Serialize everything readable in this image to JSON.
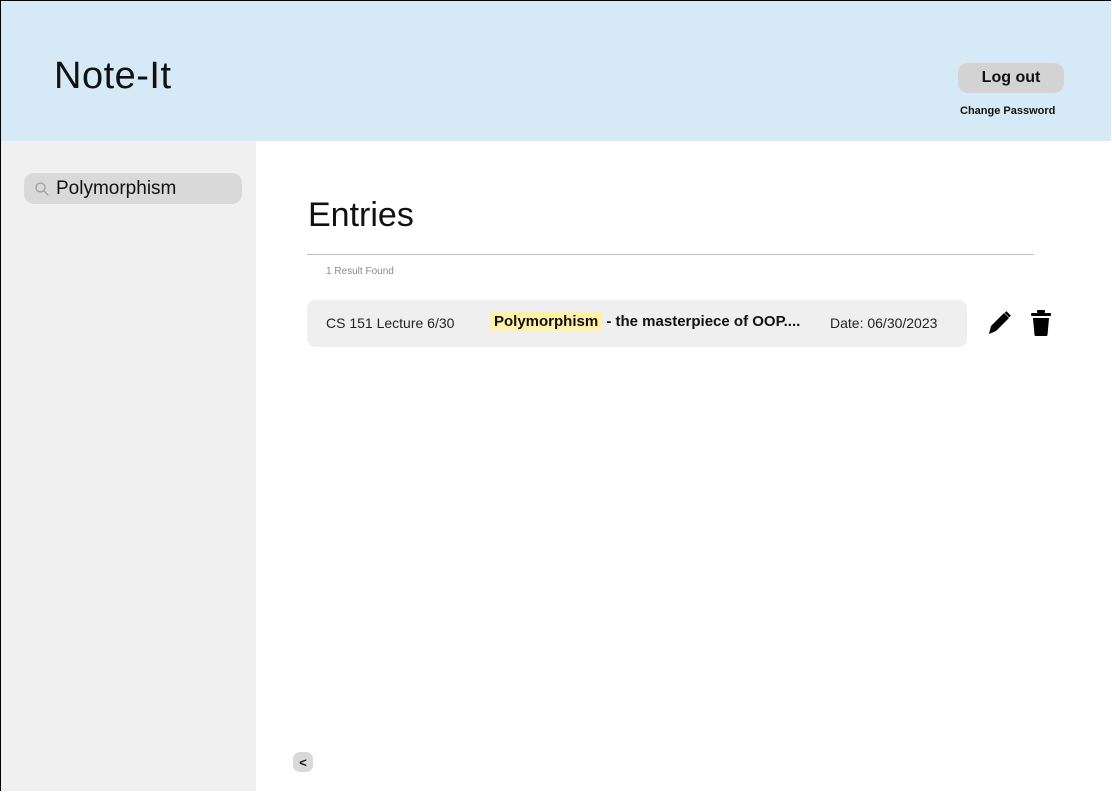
{
  "header": {
    "app_title": "Note-It",
    "logout_label": "Log out",
    "change_password_label": "Change Password"
  },
  "sidebar": {
    "search": {
      "value": "Polymorphism",
      "icon": "search-icon"
    }
  },
  "main": {
    "title": "Entries",
    "result_count": "1 Result Found",
    "entries": [
      {
        "course": "CS 151 Lecture 6/30",
        "title_highlight": "Polymorphism",
        "title_rest": " - the masterpiece of OOP....",
        "date": "Date: 06/30/2023",
        "actions": [
          "pencil-icon",
          "trash-icon"
        ]
      }
    ],
    "collapse_label": "<"
  },
  "colors": {
    "header_bg": "#d5eaf6",
    "sidebar_bg": "#f0f0f0",
    "highlight": "#fff2a8",
    "button_gray": "#d3d3d3"
  }
}
